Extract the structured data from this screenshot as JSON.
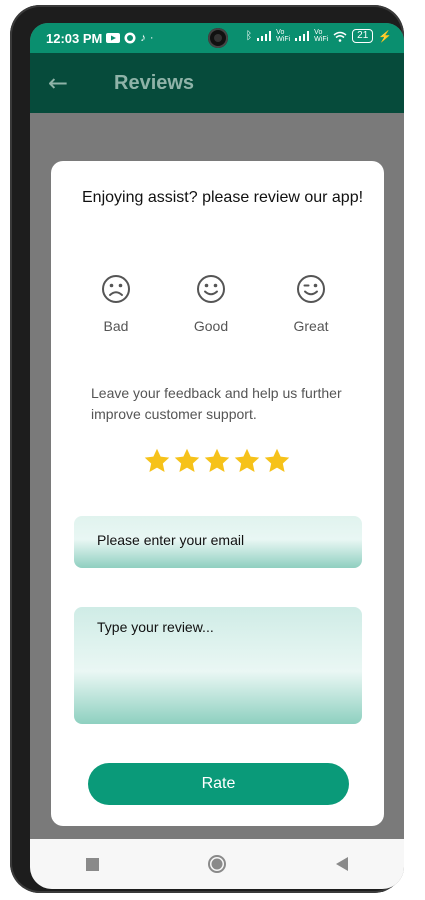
{
  "status_bar": {
    "time": "12:03 PM",
    "left_icons": [
      "youtube-icon",
      "whatsapp-icon",
      "tiktok-icon",
      "dot-icon"
    ],
    "right_icons": [
      "bluetooth-icon",
      "signal-icon",
      "signal-icon",
      "wifi-icon",
      "battery-icon",
      "charging-icon"
    ],
    "network_label_1": "Vo WiFi",
    "network_label_2": "Vo WiFi",
    "battery_level": "21"
  },
  "app_bar": {
    "title": "Reviews",
    "back_icon": "back-arrow-icon",
    "color": "#064b3b"
  },
  "dialog": {
    "title": "Enjoying assist? please review our app!",
    "moods": [
      {
        "label": "Bad",
        "icon": "sad-face-icon"
      },
      {
        "label": "Good",
        "icon": "smile-face-icon"
      },
      {
        "label": "Great",
        "icon": "wink-face-icon"
      }
    ],
    "feedback_prompt": "Leave your feedback and help us further improve customer support.",
    "rating": {
      "value": 5,
      "max": 5,
      "color": "#f6c21a"
    },
    "email_placeholder": "Please enter your email",
    "review_placeholder": "Type your review...",
    "rate_button": "Rate",
    "accent": "#0a9a79"
  },
  "nav_bar": {
    "items": [
      "recent-apps-icon",
      "home-icon",
      "back-icon"
    ]
  }
}
